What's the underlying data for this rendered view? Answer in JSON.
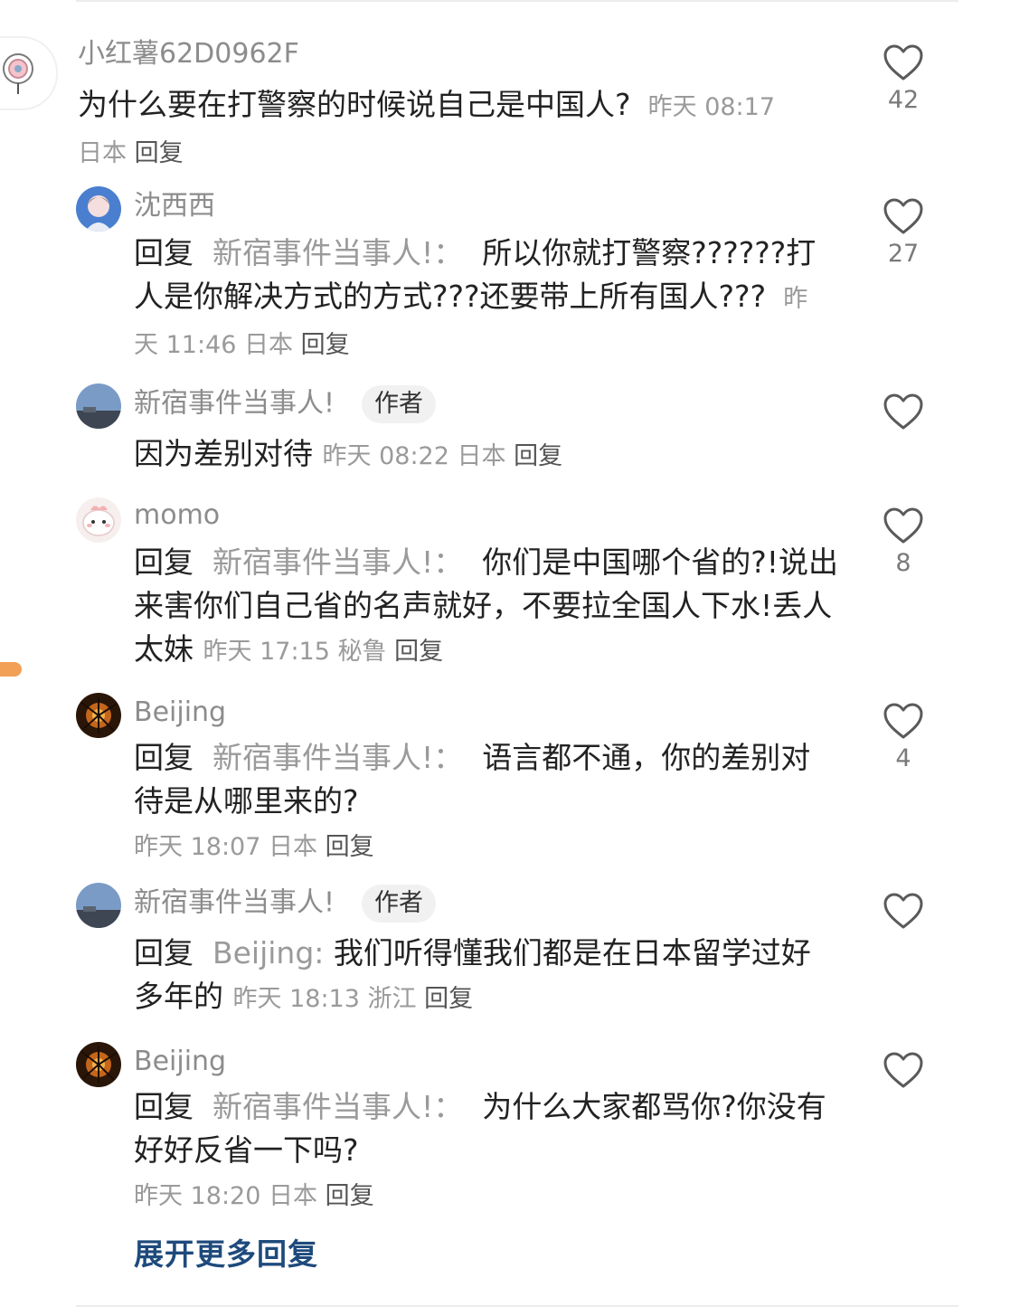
{
  "comments": [
    {
      "username": "小红薯62D0962F",
      "text": "为什么要在打警察的时候说自己是中国人?",
      "time": "昨天 08:17",
      "location": "日本",
      "reply_label": "回复",
      "likes": "42"
    },
    {
      "username": "沈西西",
      "reply_prefix": "回复",
      "mention": "新宿事件当事人!：",
      "text": "所以你就打警察??????打人是你解决方式的方式???还要带上所有国人???",
      "time": "昨天 11:46",
      "location": "日本",
      "reply_label": "回复",
      "likes": "27"
    },
    {
      "username": "新宿事件当事人!",
      "badge": "作者",
      "text": "因为差别对待",
      "time": "昨天 08:22",
      "location": "日本",
      "reply_label": "回复",
      "likes": ""
    },
    {
      "username": "momo",
      "reply_prefix": "回复",
      "mention": "新宿事件当事人!：",
      "text": "你们是中国哪个省的?!说出来害你们自己省的名声就好，不要拉全国人下水!丢人太妹",
      "time": "昨天 17:15",
      "location": "秘鲁",
      "reply_label": "回复",
      "likes": "8"
    },
    {
      "username": "Beijing",
      "reply_prefix": "回复",
      "mention": "新宿事件当事人!：",
      "text": "语言都不通，你的差别对待是从哪里来的?",
      "time": "昨天 18:07",
      "location": "日本",
      "reply_label": "回复",
      "likes": "4"
    },
    {
      "username": "新宿事件当事人!",
      "badge": "作者",
      "reply_prefix": "回复",
      "mention": "Beijing:",
      "text": "我们听得懂我们都是在日本留学过好多年的",
      "time": "昨天 18:13",
      "location": "浙江",
      "reply_label": "回复",
      "likes": ""
    },
    {
      "username": "Beijing",
      "reply_prefix": "回复",
      "mention": "新宿事件当事人!：",
      "text": "为什么大家都骂你?你没有好好反省一下吗?",
      "time": "昨天 18:20",
      "location": "日本",
      "reply_label": "回复",
      "likes": ""
    }
  ],
  "expand_more_label": "展开更多回复",
  "colors": {
    "accent_link": "#1e4a7c",
    "muted": "#9a9a9a",
    "side_mark": "#f2a056"
  },
  "icons": {
    "like": "heart-outline-icon"
  }
}
